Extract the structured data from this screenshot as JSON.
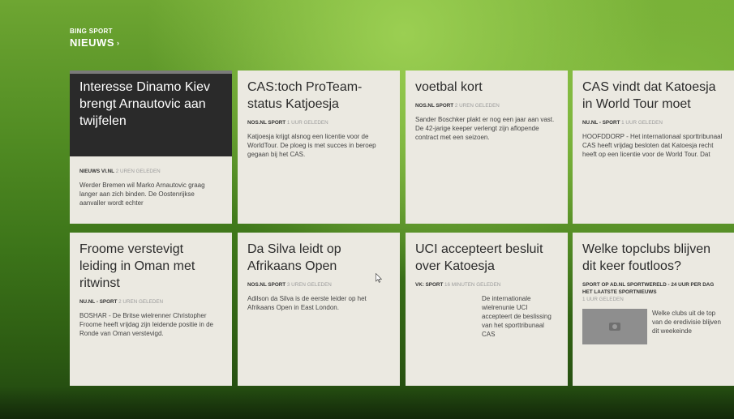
{
  "app": {
    "title": "BING SPORT"
  },
  "section": {
    "title": "NIEUWS",
    "chevron_icon": "chevron-right-icon"
  },
  "tiles": [
    {
      "headline": "Interesse Dinamo Kiev brengt Arnautovic aan twijfelen",
      "source": "NIEUWS VI.NL",
      "time": "2 UREN GELEDEN",
      "snippet": "Werder Bremen wil Marko Arnautovic graag langer aan zich binden. De Oostenrijkse aanvaller wordt echter"
    },
    {
      "headline": "CAS:toch ProTeam-status Katjoesja",
      "source": "NOS.NL SPORT",
      "time": "1 UUR GELEDEN",
      "snippet": "Katjoesja krijgt alsnog een licentie voor de WorldTour. De ploeg is met succes in beroep gegaan bij het CAS."
    },
    {
      "headline": "voetbal kort",
      "source": "NOS.NL SPORT",
      "time": "2 UREN GELEDEN",
      "snippet": "Sander Boschker plakt er nog een jaar aan vast. De 42-jarige keeper verlengt zijn aflopende contract met een seizoen."
    },
    {
      "headline": "CAS vindt dat Katoesja in World Tour moet",
      "source": "NU.NL - SPORT",
      "time": "1 UUR GELEDEN",
      "snippet": "HOOFDDORP - Het internationaal sporttribunaal CAS heeft vrijdag besloten dat Katoesja recht heeft op een licentie voor de World Tour. Dat"
    },
    {
      "headline": "Froome verstevigt leiding in Oman met ritwinst",
      "source": "NU.NL - SPORT",
      "time": "2 UREN GELEDEN",
      "snippet": "BOSHAR - De Britse wielrenner Christopher Froome heeft vrijdag zijn leidende positie in de Ronde van Oman verstevigd."
    },
    {
      "headline": "Da Silva leidt op Afrikaans Open",
      "source": "NOS.NL SPORT",
      "time": "3 UREN GELEDEN",
      "snippet": "Adilson da Silva is de eerste leider op het Afrikaans Open in East London."
    },
    {
      "headline": "UCI accepteert besluit over Katoesja",
      "source": "VK: SPORT",
      "time": "16 MINUTEN GELEDEN",
      "snippet": "De internationale wielrenunie UCI accepteert de beslissing van het sporttribunaal CAS"
    },
    {
      "headline": "Welke topclubs blijven dit keer foutloos?",
      "source": "SPORT OP AD.NL SPORTWERELD - 24 UUR PER DAG HET LAATSTE SPORTNIEUWS",
      "time": "1 UUR GELEDEN",
      "snippet": "Welke clubs uit de top van de eredivisie blijven dit weekeinde",
      "thumbnail_icon": "camera-icon"
    }
  ]
}
